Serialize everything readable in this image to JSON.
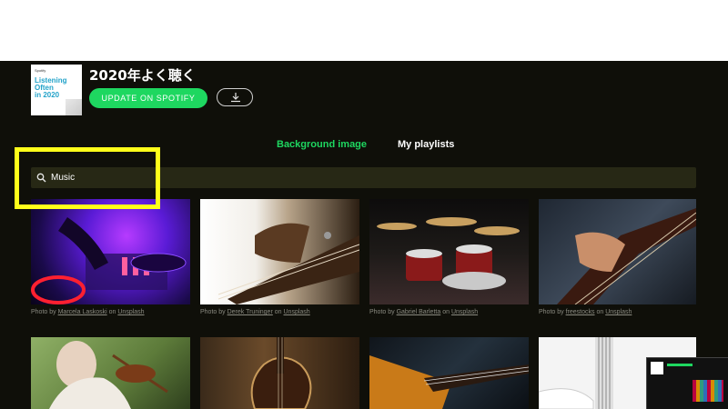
{
  "playlist": {
    "title": "2020年よく聴く",
    "cover": {
      "small_text": "Spotify",
      "title_line1": "Listening",
      "title_line2": "Often",
      "title_line3": "in 2020"
    },
    "update_button_label": "UPDATE ON SPOTIFY",
    "download_icon": "download-icon"
  },
  "tabs": [
    {
      "label": "Background image",
      "active": true
    },
    {
      "label": "My playlists",
      "active": false
    }
  ],
  "search": {
    "value": "Music",
    "icon": "search-icon"
  },
  "photos": [
    {
      "subject": "dj-turntable",
      "author": "Marcela Laskoski",
      "source": "Unsplash"
    },
    {
      "subject": "bass-guitar-player",
      "author": "Derek Truninger",
      "source": "Unsplash"
    },
    {
      "subject": "drum-kit",
      "author": "Gabriel Barletta",
      "source": "Unsplash"
    },
    {
      "subject": "electric-guitar",
      "author": "freestocks",
      "source": "Unsplash"
    },
    {
      "subject": "violinist",
      "author": "",
      "source": ""
    },
    {
      "subject": "wooden-guitar",
      "author": "",
      "source": ""
    },
    {
      "subject": "guitar-neck",
      "author": "",
      "source": ""
    },
    {
      "subject": "white-bass",
      "author": "",
      "source": ""
    }
  ],
  "credit": {
    "prefix": "Photo by",
    "joiner": "on"
  },
  "colors": {
    "accent": "#1ed760",
    "background": "#0f0f09",
    "search_background": "#272815",
    "highlight": "#ffff1a"
  }
}
